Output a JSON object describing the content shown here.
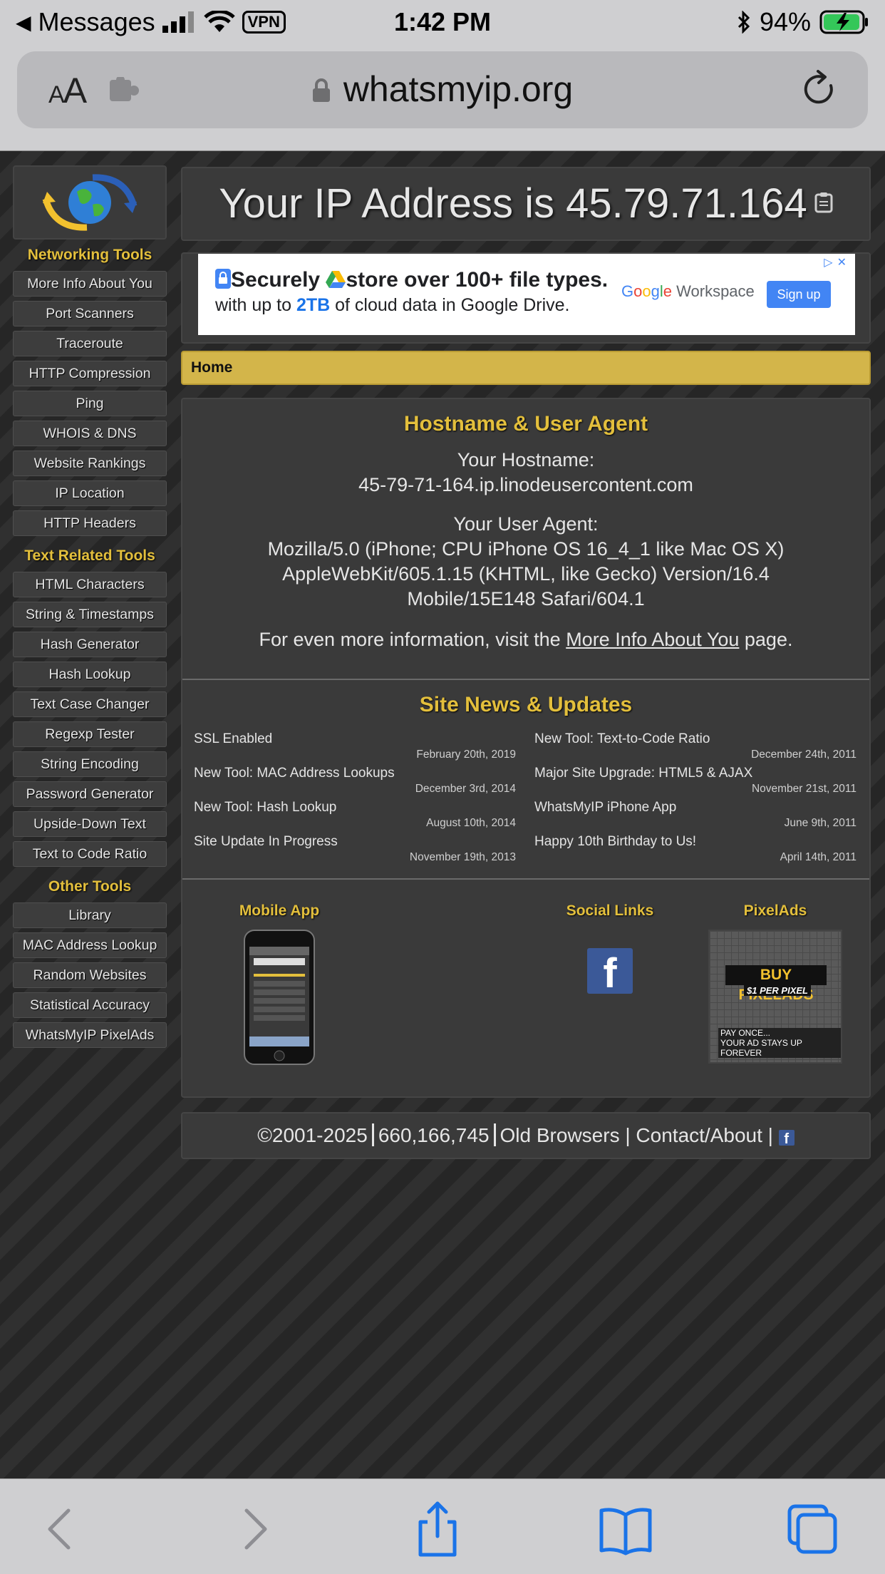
{
  "status_bar": {
    "back_app": "Messages",
    "vpn": "VPN",
    "time": "1:42 PM",
    "battery": "94%"
  },
  "browser": {
    "text_size_label_small": "A",
    "text_size_label_large": "A",
    "url": "whatsmyip.org"
  },
  "sidebar": {
    "networking_heading": "Networking Tools",
    "networking_items": [
      "More Info About You",
      "Port Scanners",
      "Traceroute",
      "HTTP Compression",
      "Ping",
      "WHOIS & DNS",
      "Website Rankings",
      "IP Location",
      "HTTP Headers"
    ],
    "text_heading": "Text Related Tools",
    "text_items": [
      "HTML Characters",
      "String & Timestamps",
      "Hash Generator",
      "Hash Lookup",
      "Text Case Changer",
      "Regexp Tester",
      "String Encoding",
      "Password Generator",
      "Upside-Down Text",
      "Text to Code Ratio"
    ],
    "other_heading": "Other Tools",
    "other_items": [
      "Library",
      "MAC Address Lookup",
      "Random Websites",
      "Statistical Accuracy",
      "WhatsMyIP PixelAds"
    ]
  },
  "ip_banner": {
    "text": "Your IP Address is 45.79.71.164"
  },
  "ad": {
    "line1_a": "Securely",
    "line1_b": "store over 100+ file types.",
    "line2_a": "with up to ",
    "line2_b": "2TB",
    "line2_c": " of cloud data in Google Drive.",
    "brand": "Workspace",
    "cta": "Sign up"
  },
  "breadcrumb": {
    "home": "Home"
  },
  "hostname_section": {
    "title": "Hostname & User Agent",
    "hostname_label": "Your Hostname:",
    "hostname_value": "45-79-71-164.ip.linodeusercontent.com",
    "agent_label": "Your User Agent:",
    "agent_line1": "Mozilla/5.0 (iPhone; CPU iPhone OS 16_4_1 like Mac OS X)",
    "agent_line2": "AppleWebKit/605.1.15 (KHTML, like Gecko) Version/16.4",
    "agent_line3": "Mobile/15E148 Safari/604.1",
    "more_prefix": "For even more information, visit the ",
    "more_link": "More Info About You",
    "more_suffix": " page."
  },
  "news": {
    "title": "Site News & Updates",
    "left": [
      {
        "title": "SSL Enabled",
        "date": "February 20th, 2019"
      },
      {
        "title": "New Tool: MAC Address Lookups",
        "date": "December 3rd, 2014"
      },
      {
        "title": "New Tool: Hash Lookup",
        "date": "August 10th, 2014"
      },
      {
        "title": "Site Update In Progress",
        "date": "November 19th, 2013"
      }
    ],
    "right": [
      {
        "title": "New Tool: Text-to-Code Ratio",
        "date": "December 24th, 2011"
      },
      {
        "title": "Major Site Upgrade: HTML5 & AJAX",
        "date": "November 21st, 2011"
      },
      {
        "title": "WhatsMyIP iPhone App",
        "date": "June 9th, 2011"
      },
      {
        "title": "Happy 10th Birthday to Us!",
        "date": "April 14th, 2011"
      }
    ]
  },
  "footer_links": {
    "mobile_app": "Mobile App",
    "social_links": "Social Links",
    "pixelads": "PixelAds",
    "pixelads_title": "BUY PIXELADS",
    "pixelads_sub": "$1 PER PIXEL",
    "pixelads_foot1": "PAY ONCE...",
    "pixelads_foot2": "YOUR AD STAYS UP FOREVER"
  },
  "footer": {
    "copyright": "©2001-2025",
    "count": "660,166,745",
    "old_browsers": "Old Browsers",
    "contact": "Contact/About"
  }
}
